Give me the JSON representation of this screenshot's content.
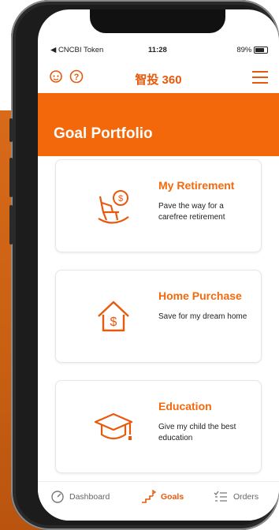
{
  "status": {
    "carrier": "◀ CNCBI Token",
    "time": "11:28",
    "battery": "89%"
  },
  "topbar": {
    "brand": "智投 360"
  },
  "header": {
    "title": "Goal Portfolio"
  },
  "goals": [
    {
      "title": "My Retirement",
      "description": "Pave the way for a carefree retirement",
      "icon": "rocking-chair-coin-icon"
    },
    {
      "title": "Home Purchase",
      "description": "Save for my dream home",
      "icon": "house-dollar-icon"
    },
    {
      "title": "Education",
      "description": "Give my child the best education",
      "icon": "graduation-cap-icon"
    }
  ],
  "tabs": [
    {
      "label": "Dashboard",
      "icon": "gauge-icon",
      "active": false
    },
    {
      "label": "Goals",
      "icon": "flag-steps-icon",
      "active": true
    },
    {
      "label": "Orders",
      "icon": "checklist-icon",
      "active": false
    }
  ],
  "colors": {
    "accent": "#f2680a",
    "accent_text": "#e8590c"
  }
}
